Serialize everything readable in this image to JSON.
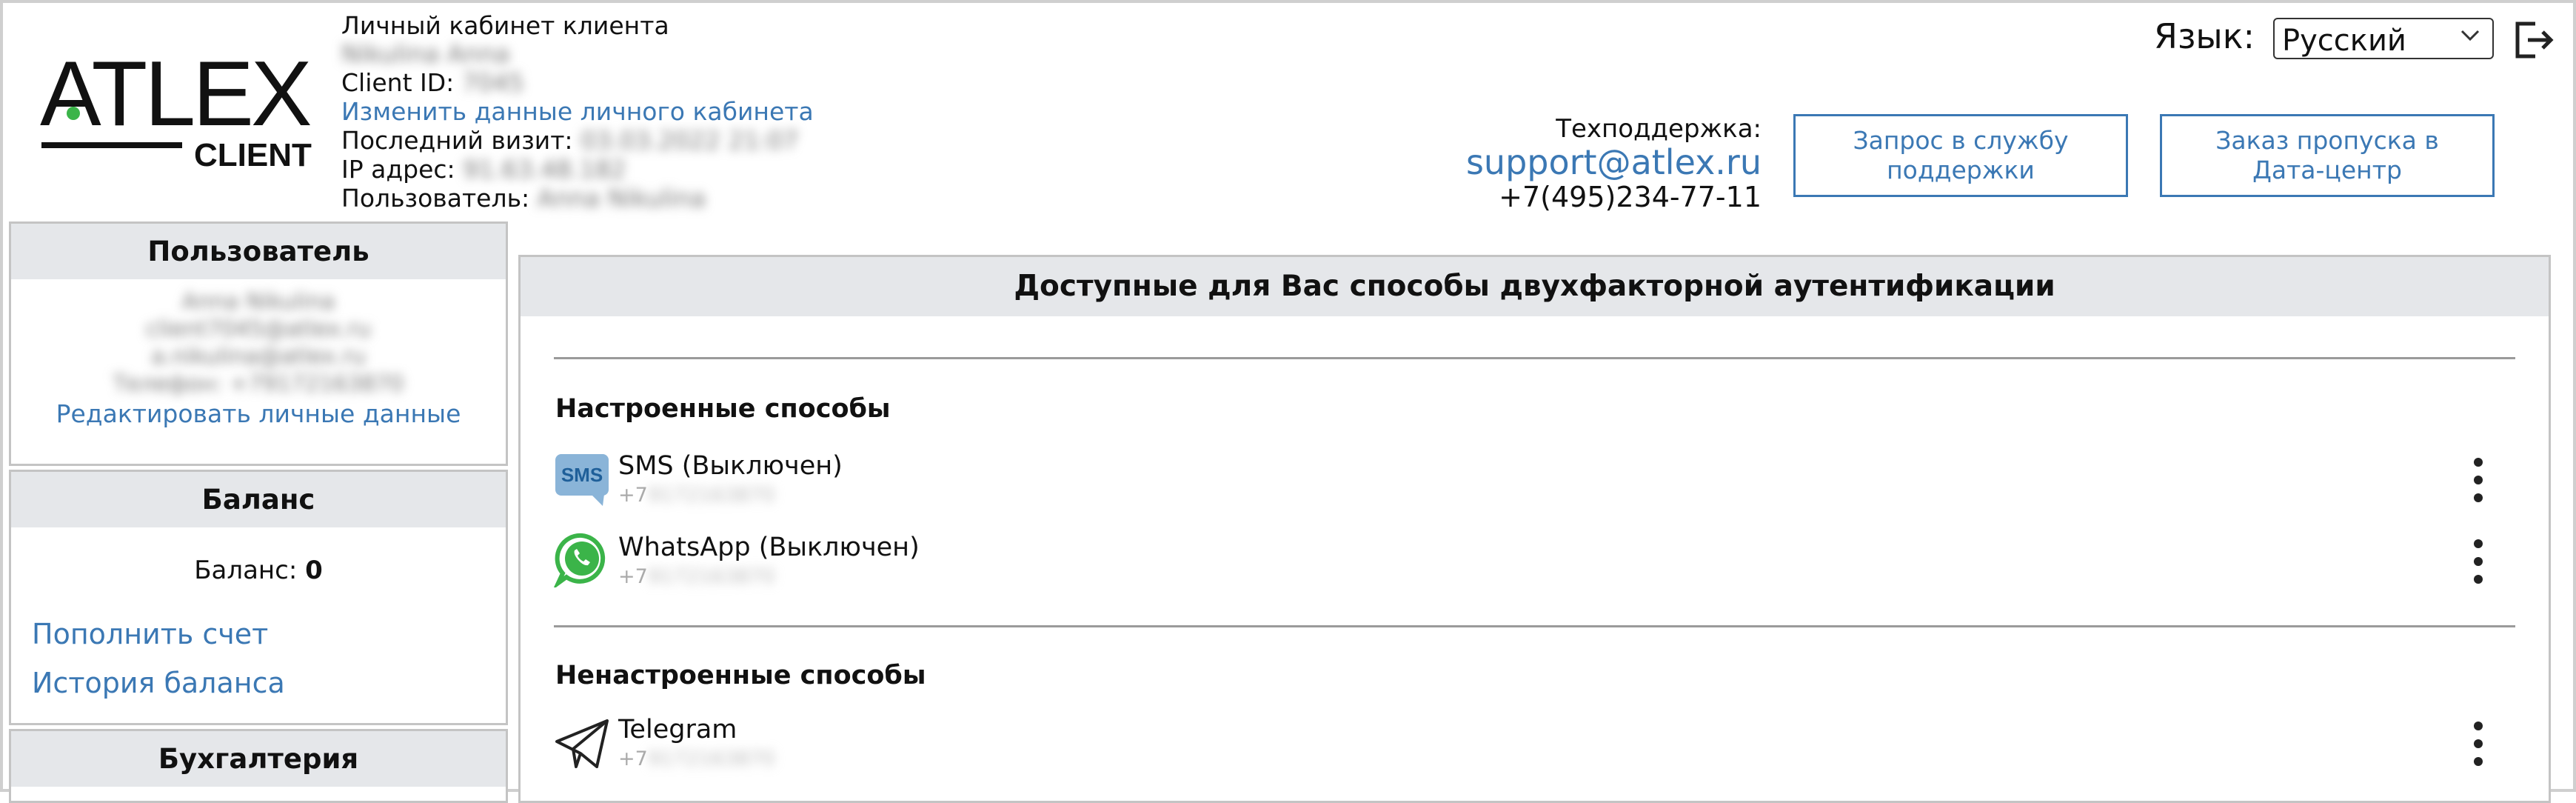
{
  "header": {
    "logo_text": "ATLEX",
    "logo_sub": "CLIENT",
    "title": "Личный кабинет клиента",
    "client_name": "Nikulina Anna",
    "client_id_label": "Client ID:",
    "client_id": "7045",
    "edit_link": "Изменить данные личного кабинета",
    "last_visit_label": "Последний визит:",
    "last_visit": "03.03.2022 21:07",
    "ip_label": "IP адрес:",
    "ip": "91.63.48.182",
    "user_label": "Пользователь:",
    "user": "Anna Nikulina",
    "lang_label": "Язык:",
    "lang_selected": "Русский",
    "support_label": "Техподдержка:",
    "support_email": "support@atlex.ru",
    "support_phone": "+7(495)234-77-11",
    "btn_support": "Запрос в службу поддержки",
    "btn_pass": "Заказ пропуска в Дата-центр"
  },
  "sidebar": {
    "user_title": "Пользователь",
    "user_name": "Anna Nikulina",
    "user_login": "client7045@atlex.ru",
    "user_email": "a.nikulina@atlex.ru",
    "user_phone": "Телефон: +79172163870",
    "edit_profile": "Редактировать личные данные",
    "balance_title": "Баланс",
    "balance_label": "Баланс:",
    "balance_value": "0",
    "topup": "Пополнить счет",
    "history": "История баланса",
    "accounting_title": "Бухгалтерия"
  },
  "main": {
    "title": "Доступные для Вас способы двухфакторной аутентификации",
    "configured_title": "Настроенные способы",
    "unconfigured_title": "Ненастроенные способы",
    "configured": [
      {
        "name": "SMS (Выключен)",
        "prefix": "+7",
        "number": "9172163870",
        "icon": "sms-icon"
      },
      {
        "name": "WhatsApp (Выключен)",
        "prefix": "+7",
        "number": "9172163870",
        "icon": "whatsapp-icon"
      }
    ],
    "unconfigured": [
      {
        "name": "Telegram",
        "prefix": "+7",
        "number": "9172163870",
        "icon": "telegram-icon"
      }
    ]
  },
  "colors": {
    "link": "#3b78b4",
    "panel_head": "#e5e7ea",
    "whatsapp": "#3bb449"
  }
}
